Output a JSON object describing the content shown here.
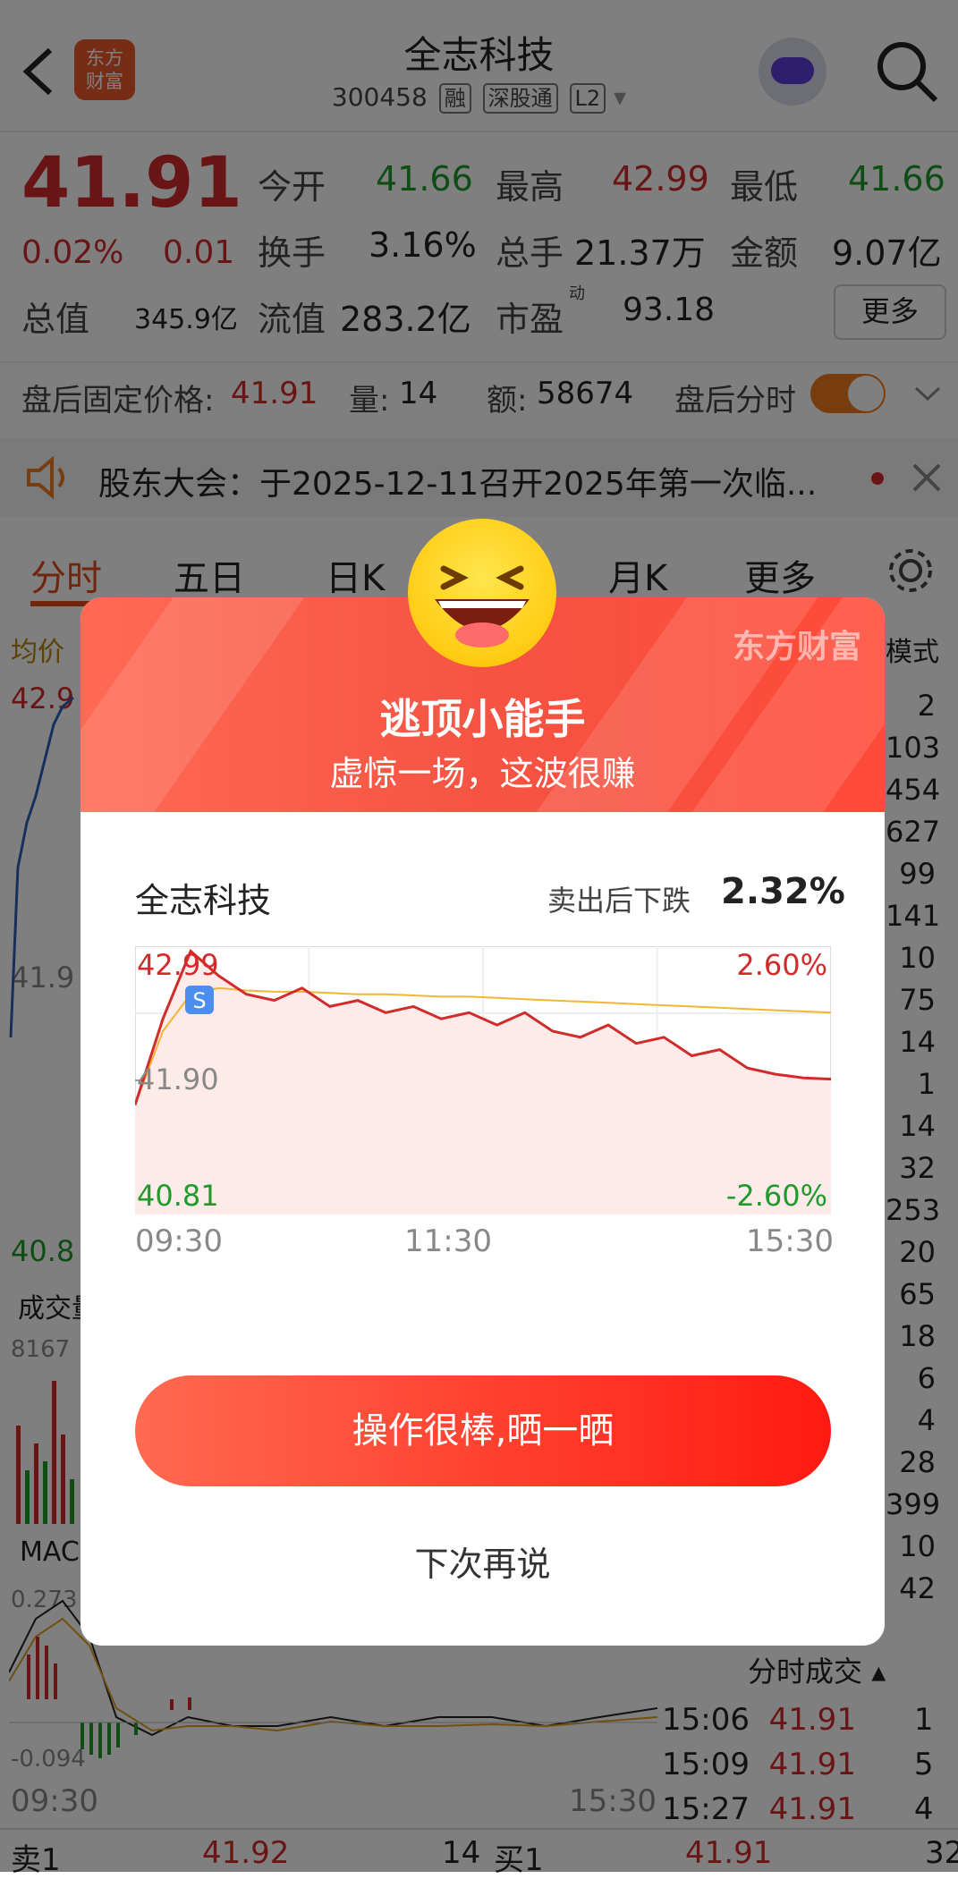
{
  "header": {
    "title": "全志科技",
    "code": "300458",
    "tags": [
      "融",
      "深股通",
      "L2"
    ],
    "logo_text": "东方\n财富"
  },
  "quote": {
    "price": "41.91",
    "change_pct": "0.02%",
    "change": "0.01",
    "open_label": "今开",
    "open": "41.66",
    "high_label": "最高",
    "high": "42.99",
    "low_label": "最低",
    "low": "41.66",
    "turnover_label": "换手",
    "turnover": "3.16%",
    "volume_label": "总手",
    "volume": "21.37万",
    "amount_label": "金额",
    "amount": "9.07亿",
    "mktcap_label": "总值",
    "mktcap": "345.9亿",
    "float_label": "流值",
    "float": "283.2亿",
    "pe_label": "市盈",
    "pe_sup": "动",
    "pe": "93.18",
    "more": "更多"
  },
  "afterhours": {
    "price_label": "盘后固定价格:",
    "price": "41.91",
    "qty_label": "量:",
    "qty": "14",
    "amt_label": "额:",
    "amt": "58674",
    "toggle_label": "盘后分时"
  },
  "notice": {
    "text": "股东大会：于2025-12-11召开2025年第一次临..."
  },
  "tabs": [
    "分时",
    "五日",
    "日K",
    "月K",
    "更多"
  ],
  "background": {
    "avg_label": "均价",
    "mode_label": "模式",
    "left_price_top": "42.9",
    "left_price_mid": "41.9",
    "left_price_low": "40.8",
    "volume_label": "成交量",
    "volume_val": "8167",
    "macd_label": "MAC",
    "macd_top": "0.273",
    "macd_low": "-0.094",
    "time_start": "09:30",
    "time_end": "15:30",
    "right_col": [
      "2",
      "103",
      "454",
      "627",
      "99",
      "141",
      "10",
      "75",
      "14",
      "1",
      "14",
      "32",
      "253",
      "20",
      "65",
      "18",
      "6",
      "4",
      "28",
      "399",
      "10",
      "42"
    ],
    "trades_label": "分时成交",
    "trades": [
      {
        "time": "15:06",
        "price": "41.91",
        "vol": "1"
      },
      {
        "time": "15:09",
        "price": "41.91",
        "vol": "5"
      },
      {
        "time": "15:27",
        "price": "41.91",
        "vol": "4"
      }
    ],
    "bottom": {
      "sell_label": "卖1",
      "sell_price": "41.92",
      "sell_vol": "14",
      "buy_label": "买1",
      "buy_price": "41.91",
      "buy_vol": "32"
    }
  },
  "modal": {
    "brand": "东方财富",
    "title": "逃顶小能手",
    "subtitle": "虚惊一场，这波很赚",
    "stock": "全志科技",
    "drop_label": "卖出后下跌",
    "drop_value": "2.32%",
    "cta": "操作很棒,晒一晒",
    "later": "下次再说",
    "chart_top_label": "42.99",
    "chart_mid_label": "41.90",
    "chart_bottom_label": "40.81",
    "pct_top": "2.60%",
    "pct_bottom": "-2.60%",
    "time_start": "09:30",
    "time_mid": "11:30",
    "time_end": "15:30",
    "marker": "S"
  },
  "chart_data": {
    "type": "line",
    "x": [
      "09:30",
      "09:40",
      "09:50",
      "10:00",
      "10:10",
      "10:20",
      "10:30",
      "10:40",
      "10:50",
      "11:00",
      "11:10",
      "11:20",
      "11:30",
      "13:10",
      "13:20",
      "13:30",
      "13:40",
      "13:50",
      "14:00",
      "14:10",
      "14:20",
      "14:30",
      "14:40",
      "14:50",
      "15:00",
      "15:30"
    ],
    "series": [
      {
        "values": [
          41.7,
          42.4,
          42.95,
          42.75,
          42.6,
          42.55,
          42.65,
          42.5,
          42.55,
          42.45,
          42.5,
          42.4,
          42.45,
          42.35,
          42.45,
          42.3,
          42.25,
          42.35,
          42.2,
          42.25,
          42.1,
          42.15,
          42.0,
          41.95,
          41.92,
          41.91
        ],
        "color": "#d22b2b"
      },
      {
        "values": [
          41.7,
          42.3,
          42.6,
          42.65,
          42.63,
          42.62,
          42.62,
          42.61,
          42.6,
          42.6,
          42.59,
          42.58,
          42.58,
          42.57,
          42.56,
          42.55,
          42.54,
          42.53,
          42.52,
          42.51,
          42.5,
          42.49,
          42.48,
          42.47,
          42.46,
          42.45
        ],
        "color": "#f2b632"
      }
    ],
    "ylim": [
      40.81,
      42.99
    ],
    "grid": true
  }
}
